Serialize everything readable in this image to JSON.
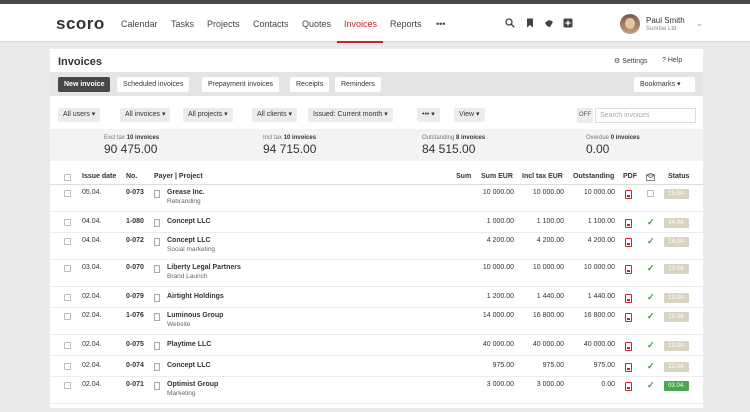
{
  "app": {
    "logo": "scoro",
    "nav": [
      "Calendar",
      "Tasks",
      "Projects",
      "Contacts",
      "Quotes",
      "Invoices",
      "Reports"
    ],
    "nav_more": "•••",
    "user_name": "Paul Smith",
    "user_company": "Sunrise Ltd"
  },
  "page": {
    "title": "Invoices",
    "settings": "Settings",
    "help": "Help",
    "tabs": [
      "New invoice",
      "Scheduled invoices",
      "Prepayment invoices",
      "Receipts",
      "Reminders"
    ],
    "bookmarks": "Bookmarks ▾",
    "filters": [
      "All users ▾",
      "All invoices ▾",
      "All projects ▾",
      "All clients ▾",
      "Issued: Current month ▾",
      "••• ▾",
      "View ▾"
    ],
    "search_placeholder": "Search invoices",
    "search_toggle": "OFF"
  },
  "summary": [
    {
      "label": "Excl tax",
      "count": "10 invoices",
      "value": "90 475.00"
    },
    {
      "label": "Incl tax",
      "count": "10 invoices",
      "value": "94 715.00"
    },
    {
      "label": "Outstanding",
      "count": "8 invoices",
      "value": "84 515.00"
    },
    {
      "label": "Overdue",
      "count": "0 invoices",
      "value": "0.00"
    }
  ],
  "table": {
    "headers": {
      "issue_date": "Issue date",
      "no": "No.",
      "payer": "Payer | Project",
      "sum": "Sum",
      "sum_eur": "Sum EUR",
      "incl_tax_eur": "Incl tax EUR",
      "outstanding": "Outstanding",
      "pdf": "PDF",
      "status": "Status"
    },
    "rows": [
      {
        "date": "05.04.",
        "no": "0-073",
        "payer": "Grease Inc.",
        "project": "Rebranding",
        "sum_eur": "10 000.00",
        "incl": "10 000.00",
        "outstanding": "10 000.00",
        "sent": false,
        "status": "15.04."
      },
      {
        "date": "04.04.",
        "no": "1-080",
        "payer": "Concept LLC",
        "project": "",
        "sum_eur": "1 000.00",
        "incl": "1 100.00",
        "outstanding": "1 100.00",
        "sent": true,
        "status": "14.04."
      },
      {
        "date": "04.04.",
        "no": "0-072",
        "payer": "Concept LLC",
        "project": "Social marketing",
        "sum_eur": "4 200.00",
        "incl": "4 200.00",
        "outstanding": "4 200.00",
        "sent": true,
        "status": "14.04."
      },
      {
        "date": "03.04.",
        "no": "0-070",
        "payer": "Liberty Legal Partners",
        "project": "Brand Launch",
        "sum_eur": "10 000.00",
        "incl": "10 000.00",
        "outstanding": "10 000.00",
        "sent": true,
        "status": "13.04."
      },
      {
        "date": "02.04.",
        "no": "0-079",
        "payer": "Airtight Holdings",
        "project": "",
        "sum_eur": "1 200.00",
        "incl": "1 440.00",
        "outstanding": "1 440.00",
        "sent": true,
        "status": "12.04."
      },
      {
        "date": "02.04.",
        "no": "1-076",
        "payer": "Luminous Group",
        "project": "Website",
        "sum_eur": "14 000.00",
        "incl": "16 800.00",
        "outstanding": "16 800.00",
        "sent": true,
        "status": "12.04."
      },
      {
        "date": "02.04.",
        "no": "0-075",
        "payer": "Playtime LLC",
        "project": "",
        "sum_eur": "40 000.00",
        "incl": "40 000.00",
        "outstanding": "40 000.00",
        "sent": true,
        "status": "12.04."
      },
      {
        "date": "02.04.",
        "no": "0-074",
        "payer": "Concept LLC",
        "project": "",
        "sum_eur": "975.00",
        "incl": "975.00",
        "outstanding": "975.00",
        "sent": true,
        "status": "12.04."
      },
      {
        "date": "02.04.",
        "no": "0-071",
        "payer": "Optimist Group",
        "project": "Marketing",
        "sum_eur": "3 000.00",
        "incl": "3 000.00",
        "outstanding": "0.00",
        "sent": true,
        "status": "03.04.",
        "paid": true
      }
    ]
  },
  "colors": {
    "accent": "#c8242b",
    "status_pending": "#d9d4bf",
    "status_paid": "#48a84a"
  }
}
